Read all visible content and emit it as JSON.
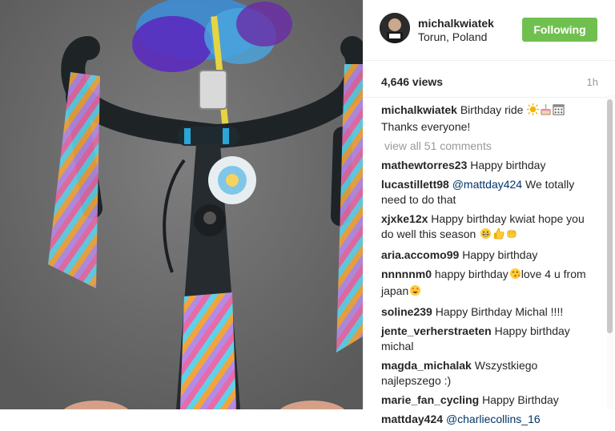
{
  "post": {
    "username": "michalkwiatek",
    "location": "Torun, Poland",
    "follow_label": "Following",
    "views": "4,646 views",
    "time_ago": "1h",
    "caption_line1": "Birthday ride",
    "caption_line2": "Thanks everyone!",
    "view_all": "view all 51 comments"
  },
  "comments": [
    {
      "user": "mathewtorres23",
      "text": "Happy birthday"
    },
    {
      "user": "lucastillett98",
      "mention": "@mattday424",
      "text": "We totally need to do that"
    },
    {
      "user": "xjxke12x",
      "text": "Happy birthday kwiat hope you do well this season"
    },
    {
      "user": "aria.accomo99",
      "text": "Happy birthday"
    },
    {
      "user": "nnnnnm0",
      "text": "happy birthday",
      "text2": "love 4 u from japan"
    },
    {
      "user": "soline239",
      "text": "Happy Birthday Michal !!!!"
    },
    {
      "user": "jente_verherstraeten",
      "text": "Happy birthday michal"
    },
    {
      "user": "magda_michalak",
      "text": "Wszystkiego najlepszego :)"
    },
    {
      "user": "marie_fan_cycling",
      "text": "Happy Birthday"
    },
    {
      "user": "mattday424",
      "mention": "@charliecollins_16",
      "text": ""
    }
  ],
  "colors": {
    "follow_bg": "#70c050",
    "road": "#6f6f70",
    "bar_tape": "#1e2326",
    "accent_blue": "#2aa7d6"
  }
}
